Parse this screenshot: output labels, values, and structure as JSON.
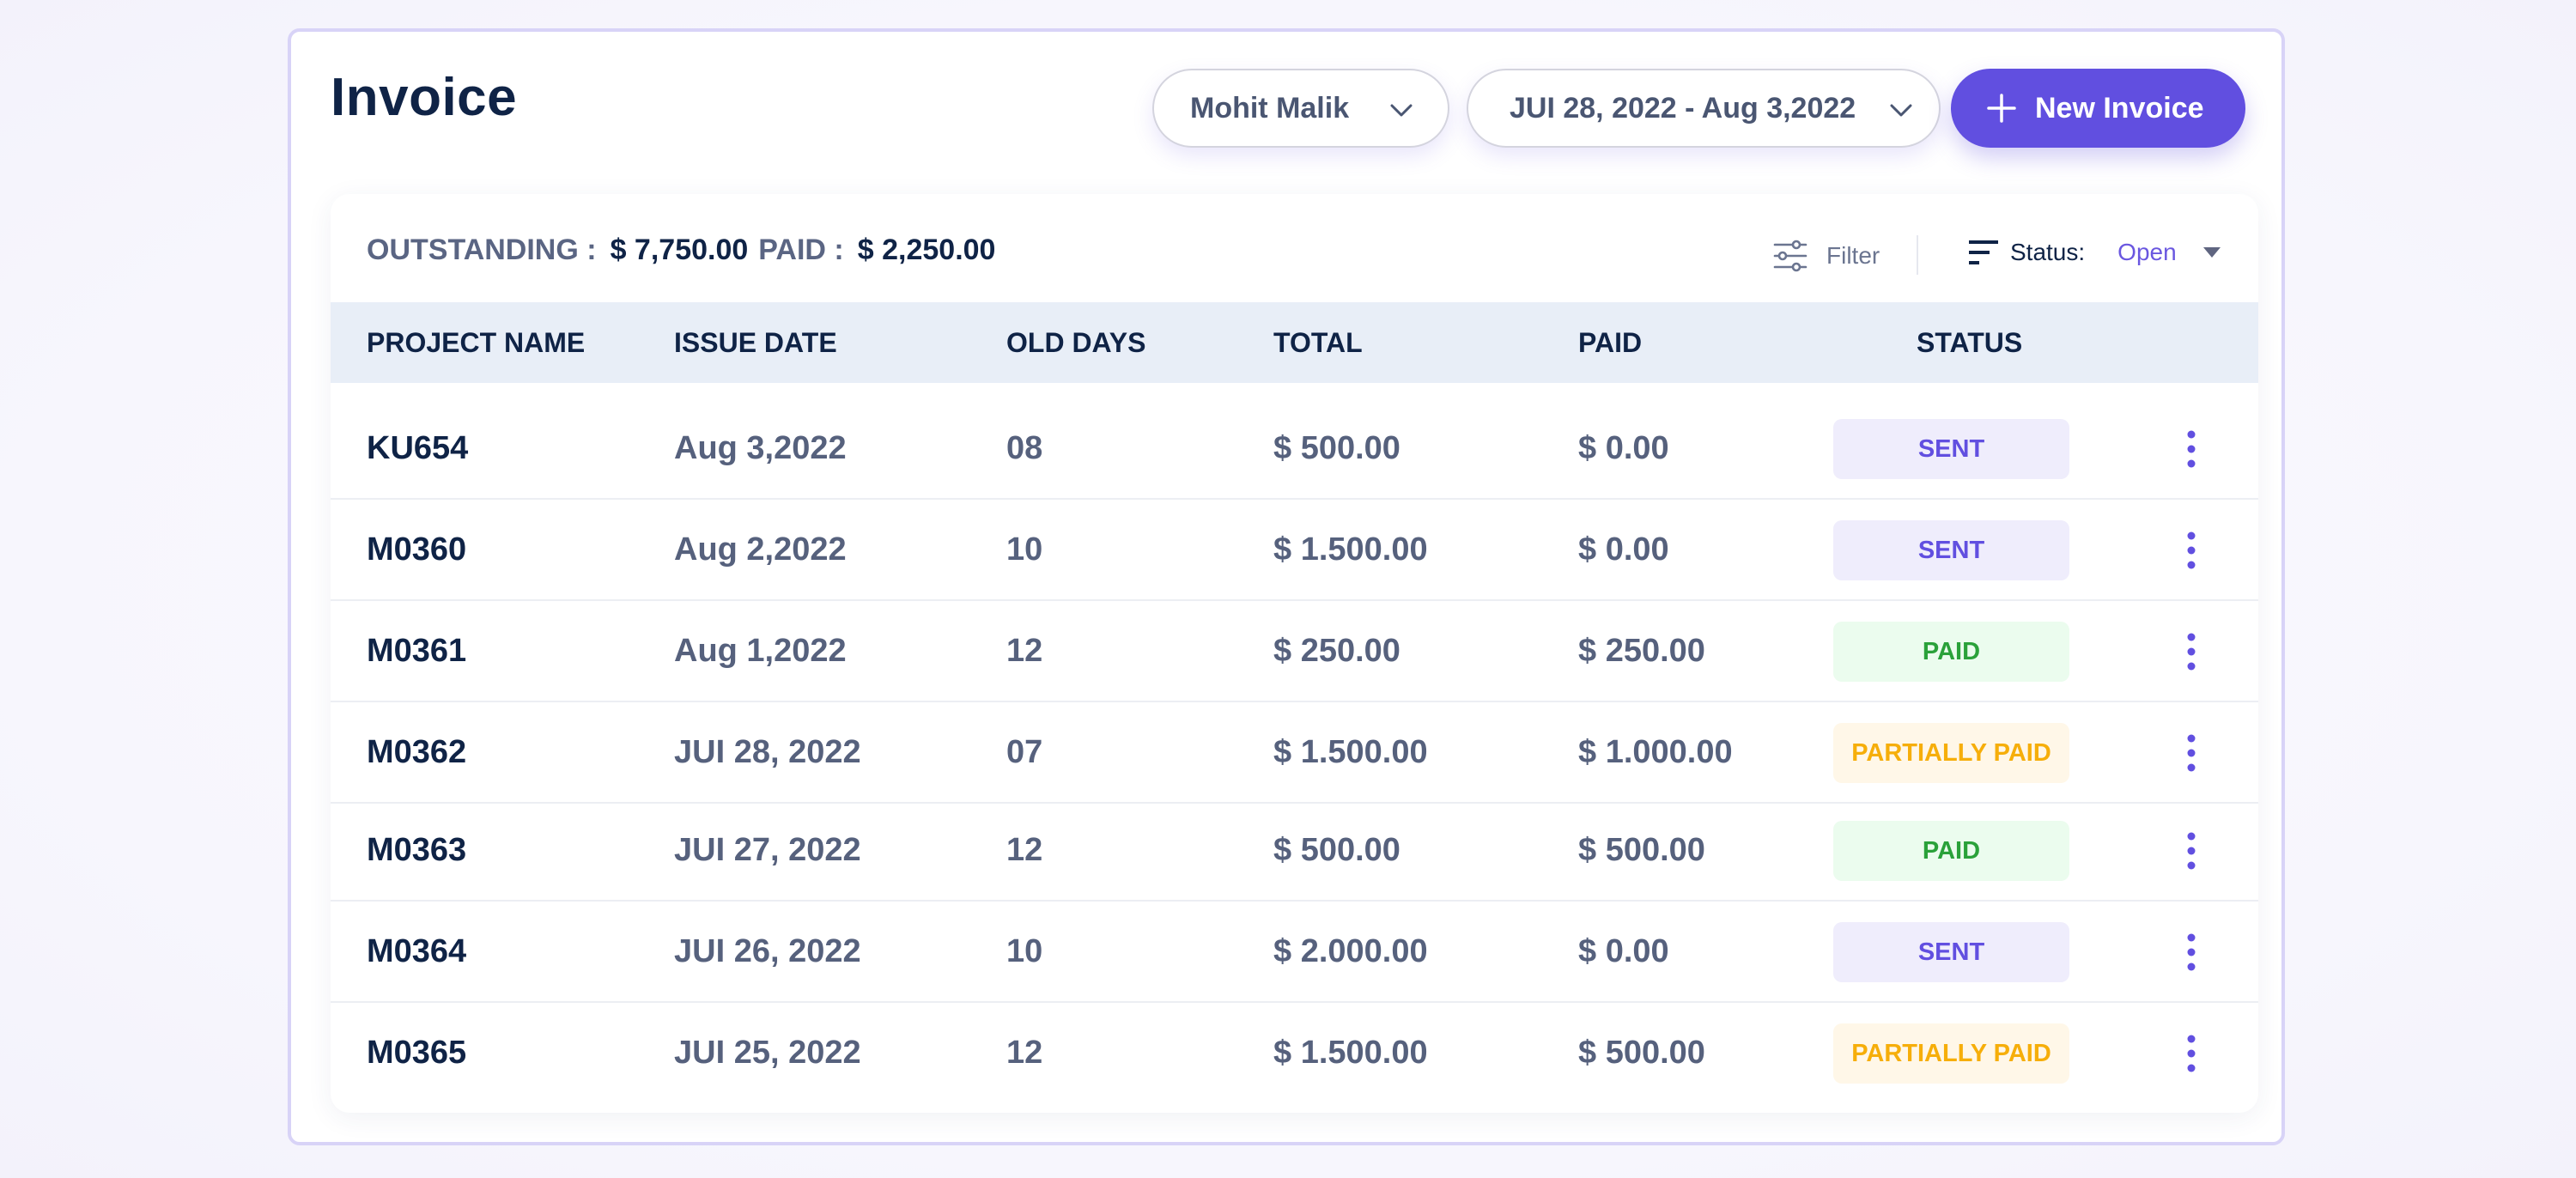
{
  "header": {
    "title": "Invoice",
    "client_select": {
      "value": "Mohit Malik",
      "icon": "chevron-down-icon"
    },
    "date_range_select": {
      "value": "JUI 28, 2022 - Aug 3,2022",
      "icon": "chevron-down-icon"
    },
    "new_invoice_button": {
      "label": "New Invoice",
      "icon": "plus-icon"
    }
  },
  "summary": {
    "outstanding_label": "OUTSTANDING :",
    "outstanding_value": "$ 7,750.00",
    "paid_label": "PAID :",
    "paid_value": "$ 2,250.00"
  },
  "toolbar": {
    "filter_label": "Filter",
    "filter_icon": "sliders-icon",
    "status_label": "Status:",
    "status_value": "Open",
    "status_icon": "sort-icon"
  },
  "colors": {
    "accent": "#614fe0",
    "sent": "#614fe0",
    "paid": "#2aa13a",
    "partially_paid": "#f6ae0a"
  },
  "table": {
    "columns": [
      "PROJECT NAME",
      "ISSUE DATE",
      "OLD DAYS",
      "TOTAL",
      "PAID",
      "STATUS"
    ],
    "rows": [
      {
        "project": "KU654",
        "issue_date": "Aug 3,2022",
        "old_days": "08",
        "total": "$ 500.00",
        "paid": "$ 0.00",
        "status": "SENT",
        "status_type": "sent"
      },
      {
        "project": "M0360",
        "issue_date": "Aug 2,2022",
        "old_days": "10",
        "total": "$ 1.500.00",
        "paid": "$ 0.00",
        "status": "SENT",
        "status_type": "sent"
      },
      {
        "project": "M0361",
        "issue_date": "Aug 1,2022",
        "old_days": "12",
        "total": "$ 250.00",
        "paid": "$ 250.00",
        "status": "PAID",
        "status_type": "paid"
      },
      {
        "project": "M0362",
        "issue_date": "JUI 28, 2022",
        "old_days": "07",
        "total": "$ 1.500.00",
        "paid": "$ 1.000.00",
        "status": "PARTIALLY PAID",
        "status_type": "partial"
      },
      {
        "project": "M0363",
        "issue_date": "JUI 27, 2022",
        "old_days": "12",
        "total": "$ 500.00",
        "paid": "$ 500.00",
        "status": "PAID",
        "status_type": "paid"
      },
      {
        "project": "M0364",
        "issue_date": "JUI 26, 2022",
        "old_days": "10",
        "total": "$ 2.000.00",
        "paid": "$ 0.00",
        "status": "SENT",
        "status_type": "sent"
      },
      {
        "project": "M0365",
        "issue_date": "JUI 25, 2022",
        "old_days": "12",
        "total": "$ 1.500.00",
        "paid": "$ 500.00",
        "status": "PARTIALLY PAID",
        "status_type": "partial"
      }
    ],
    "row_action_icon": "kebab-menu-icon"
  }
}
